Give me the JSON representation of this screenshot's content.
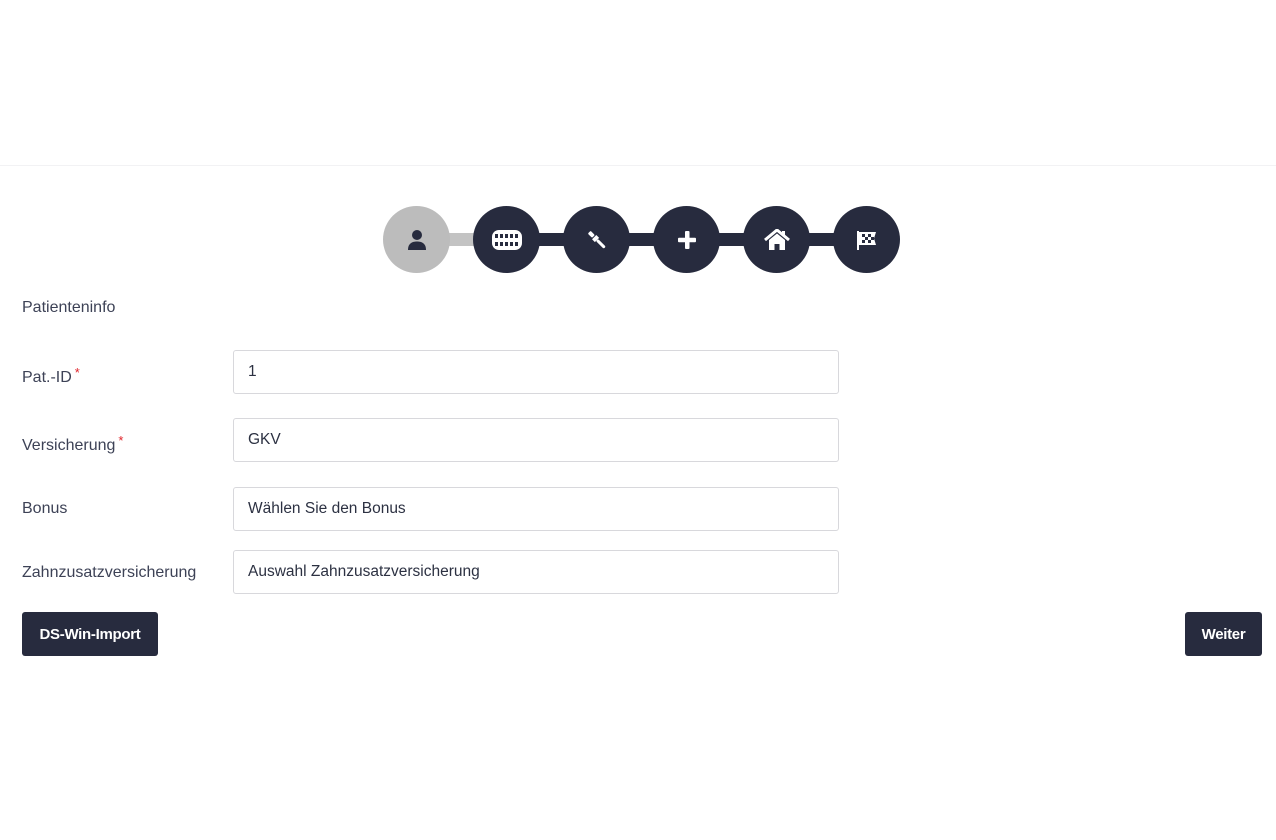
{
  "stepper": {
    "steps": [
      {
        "icon": "user-icon",
        "state": "active"
      },
      {
        "icon": "teeth-icon",
        "state": "inactive"
      },
      {
        "icon": "dental-tool-icon",
        "state": "inactive"
      },
      {
        "icon": "plus-icon",
        "state": "inactive"
      },
      {
        "icon": "home-icon",
        "state": "inactive"
      },
      {
        "icon": "checkered-flag-icon",
        "state": "inactive"
      }
    ]
  },
  "form": {
    "section_title": "Patienteninfo",
    "required_marker": "*",
    "fields": [
      {
        "label": "Pat.-ID",
        "value": "1",
        "required": true
      },
      {
        "label": "Versicherung",
        "value": "GKV",
        "required": true
      },
      {
        "label": "Bonus",
        "value": "Wählen Sie den Bonus",
        "required": false
      },
      {
        "label": "Zahnzusatzversicherung",
        "value": "Auswahl Zahnzusatzversicherung",
        "required": false
      }
    ]
  },
  "actions": {
    "import_label": "DS-Win-Import",
    "next_label": "Weiter"
  },
  "colors": {
    "primary": "#272b3e",
    "active_step": "#bcbcbc",
    "required": "#e0242b"
  }
}
